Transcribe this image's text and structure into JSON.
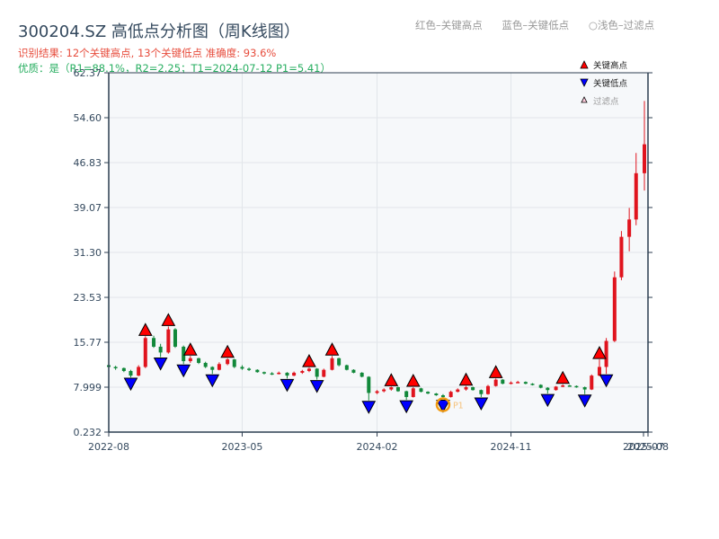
{
  "header": {
    "title": "300204.SZ 高低点分析图（周K线图）",
    "result": "识别结果: 12个关键高点, 13个关键低点   准确度: 93.6%",
    "quality": "优质：是（R1=88.1%，R2=2.25；T1=2024-07-12 P1=5.41）",
    "color_legend": [
      "红色–关键高点",
      "蓝色–关键低点",
      "○浅色–过滤点"
    ]
  },
  "colors": {
    "up": "#e0141e",
    "down": "#11883a",
    "high_marker": "#ff0000",
    "low_marker": "#0000ff",
    "filtered_circle": "#f39c12",
    "plot_bg": "#f6f8fa",
    "axis": "#2c3e50"
  },
  "chart_data": {
    "type": "candlestick",
    "title": "300204.SZ 高低点分析图（周K线图）",
    "y_ticks": [
      "0.232",
      "7.999",
      "15.77",
      "23.53",
      "31.30",
      "39.07",
      "46.83",
      "54.60",
      "62.37"
    ],
    "ylim": [
      0.232,
      62.37
    ],
    "x_ticks": [
      "2022-08",
      "2023-05",
      "2024-02",
      "2024-11",
      "2025-07",
      "2025-08"
    ],
    "xlim": [
      "2022-08-01",
      "2025-08-01"
    ],
    "grid": true,
    "legend": {
      "placement": "top-right",
      "entries": [
        "关键高点",
        "关键低点",
        "过滤点"
      ]
    },
    "candles": [
      [
        "2022-08-01",
        11.8,
        12.0,
        11.3,
        11.5
      ],
      [
        "2022-08-15",
        11.5,
        11.7,
        11.0,
        11.3
      ],
      [
        "2022-09-01",
        11.3,
        11.4,
        10.6,
        10.8
      ],
      [
        "2022-09-15",
        10.8,
        11.0,
        9.7,
        10.0
      ],
      [
        "2022-10-01",
        10.0,
        11.8,
        9.9,
        11.5
      ],
      [
        "2022-10-15",
        11.5,
        16.8,
        11.3,
        16.5
      ],
      [
        "2022-11-01",
        16.5,
        16.9,
        14.8,
        15.0
      ],
      [
        "2022-11-15",
        15.0,
        15.5,
        13.2,
        14.0
      ],
      [
        "2022-12-01",
        14.0,
        18.5,
        13.8,
        18.0
      ],
      [
        "2022-12-15",
        18.0,
        18.2,
        14.8,
        15.0
      ],
      [
        "2023-01-01",
        15.0,
        15.2,
        12.0,
        12.5
      ],
      [
        "2023-01-15",
        12.5,
        13.4,
        12.2,
        13.0
      ],
      [
        "2023-02-01",
        13.0,
        13.1,
        12.0,
        12.2
      ],
      [
        "2023-02-15",
        12.2,
        12.4,
        11.3,
        11.5
      ],
      [
        "2023-03-01",
        11.5,
        11.6,
        10.3,
        11.0
      ],
      [
        "2023-03-15",
        11.0,
        12.3,
        10.9,
        12.0
      ],
      [
        "2023-04-01",
        12.0,
        13.0,
        11.8,
        12.8
      ],
      [
        "2023-04-15",
        12.8,
        12.9,
        11.3,
        11.5
      ],
      [
        "2023-05-01",
        11.5,
        11.8,
        11.0,
        11.2
      ],
      [
        "2023-05-15",
        11.2,
        11.4,
        10.8,
        11.0
      ],
      [
        "2023-06-01",
        11.0,
        11.1,
        10.5,
        10.6
      ],
      [
        "2023-06-15",
        10.6,
        10.7,
        10.2,
        10.4
      ],
      [
        "2023-07-01",
        10.4,
        10.6,
        10.1,
        10.3
      ],
      [
        "2023-07-15",
        10.3,
        10.7,
        10.2,
        10.5
      ],
      [
        "2023-08-01",
        10.5,
        10.6,
        9.5,
        10.0
      ],
      [
        "2023-08-15",
        10.0,
        10.7,
        9.9,
        10.5
      ],
      [
        "2023-09-01",
        10.5,
        11.0,
        10.3,
        10.8
      ],
      [
        "2023-09-15",
        10.8,
        11.4,
        10.6,
        11.2
      ],
      [
        "2023-10-01",
        11.2,
        11.3,
        9.3,
        9.8
      ],
      [
        "2023-10-15",
        9.8,
        11.2,
        9.7,
        11.0
      ],
      [
        "2023-11-01",
        11.0,
        13.4,
        10.9,
        13.0
      ],
      [
        "2023-11-15",
        13.0,
        13.1,
        11.6,
        11.8
      ],
      [
        "2023-12-01",
        11.8,
        11.9,
        10.9,
        11.0
      ],
      [
        "2023-12-15",
        11.0,
        11.1,
        10.4,
        10.5
      ],
      [
        "2024-01-01",
        10.5,
        10.6,
        9.7,
        9.8
      ],
      [
        "2024-01-15",
        9.8,
        9.9,
        5.7,
        7.0
      ],
      [
        "2024-02-01",
        7.0,
        7.5,
        6.8,
        7.3
      ],
      [
        "2024-02-15",
        7.3,
        7.8,
        7.1,
        7.6
      ],
      [
        "2024-03-01",
        7.6,
        8.1,
        7.4,
        8.0
      ],
      [
        "2024-03-15",
        8.0,
        8.1,
        7.2,
        7.3
      ],
      [
        "2024-04-01",
        7.3,
        7.4,
        5.8,
        6.3
      ],
      [
        "2024-04-15",
        6.3,
        8.0,
        6.2,
        7.8
      ],
      [
        "2024-05-01",
        7.8,
        7.9,
        7.1,
        7.2
      ],
      [
        "2024-05-15",
        7.2,
        7.3,
        6.8,
        6.9
      ],
      [
        "2024-06-01",
        6.9,
        7.0,
        6.5,
        6.6
      ],
      [
        "2024-06-15",
        6.6,
        6.8,
        5.9,
        6.3
      ],
      [
        "2024-07-01",
        6.3,
        7.4,
        6.2,
        7.2
      ],
      [
        "2024-07-15",
        7.2,
        7.8,
        7.1,
        7.6
      ],
      [
        "2024-08-01",
        7.6,
        8.2,
        7.4,
        8.0
      ],
      [
        "2024-08-15",
        8.0,
        8.1,
        7.4,
        7.5
      ],
      [
        "2024-09-01",
        7.5,
        7.6,
        6.3,
        6.8
      ],
      [
        "2024-09-15",
        6.8,
        8.4,
        6.7,
        8.2
      ],
      [
        "2024-10-01",
        8.2,
        9.5,
        8.1,
        9.3
      ],
      [
        "2024-10-15",
        9.3,
        9.4,
        8.5,
        8.6
      ],
      [
        "2024-11-01",
        8.6,
        9.0,
        8.5,
        8.8
      ],
      [
        "2024-11-15",
        8.8,
        9.1,
        8.7,
        8.9
      ],
      [
        "2024-12-01",
        8.9,
        9.0,
        8.5,
        8.6
      ],
      [
        "2024-12-15",
        8.6,
        8.7,
        8.3,
        8.4
      ],
      [
        "2025-01-01",
        8.4,
        8.5,
        7.8,
        7.9
      ],
      [
        "2025-01-15",
        7.9,
        8.0,
        6.9,
        7.5
      ],
      [
        "2025-02-01",
        7.5,
        8.2,
        7.4,
        8.1
      ],
      [
        "2025-02-15",
        8.1,
        8.5,
        8.0,
        8.3
      ],
      [
        "2025-03-01",
        8.3,
        8.4,
        8.1,
        8.2
      ],
      [
        "2025-03-15",
        8.2,
        8.3,
        7.9,
        8.0
      ],
      [
        "2025-04-01",
        8.0,
        8.1,
        6.8,
        7.6
      ],
      [
        "2025-04-15",
        7.6,
        10.2,
        7.5,
        10.0
      ],
      [
        "2025-05-01",
        10.0,
        12.8,
        9.9,
        11.5
      ],
      [
        "2025-05-15",
        11.5,
        16.5,
        10.3,
        16.0
      ],
      [
        "2025-06-01",
        16.0,
        28.0,
        15.8,
        27.0
      ],
      [
        "2025-06-15",
        27.0,
        35.0,
        26.5,
        34.0
      ],
      [
        "2025-07-01",
        34.0,
        39.0,
        31.5,
        37.0
      ],
      [
        "2025-07-15",
        37.0,
        48.5,
        36.0,
        45.0
      ],
      [
        "2025-08-01",
        45.0,
        57.5,
        42.0,
        50.0
      ]
    ],
    "high_points": [
      [
        "2022-10-15",
        16.8
      ],
      [
        "2022-12-01",
        18.5
      ],
      [
        "2023-01-15",
        13.4
      ],
      [
        "2023-04-01",
        13.0
      ],
      [
        "2023-09-15",
        11.4
      ],
      [
        "2023-11-01",
        13.4
      ],
      [
        "2024-03-01",
        8.1
      ],
      [
        "2024-04-15",
        8.0
      ],
      [
        "2024-08-01",
        8.2
      ],
      [
        "2024-10-01",
        9.5
      ],
      [
        "2025-02-15",
        8.5
      ],
      [
        "2025-05-01",
        12.8
      ]
    ],
    "low_points": [
      [
        "2022-09-15",
        9.7
      ],
      [
        "2022-11-15",
        13.2
      ],
      [
        "2023-01-01",
        12.0
      ],
      [
        "2023-03-01",
        10.3
      ],
      [
        "2023-08-01",
        9.5
      ],
      [
        "2023-10-01",
        9.3
      ],
      [
        "2024-01-15",
        5.7
      ],
      [
        "2024-04-01",
        5.8
      ],
      [
        "2024-06-15",
        5.9
      ],
      [
        "2024-09-01",
        6.3
      ],
      [
        "2025-01-15",
        6.9
      ],
      [
        "2025-04-01",
        6.8
      ],
      [
        "2025-05-15",
        10.3
      ]
    ],
    "highlight": {
      "date": "2024-06-15",
      "price": 5.9,
      "label": "P1"
    }
  }
}
